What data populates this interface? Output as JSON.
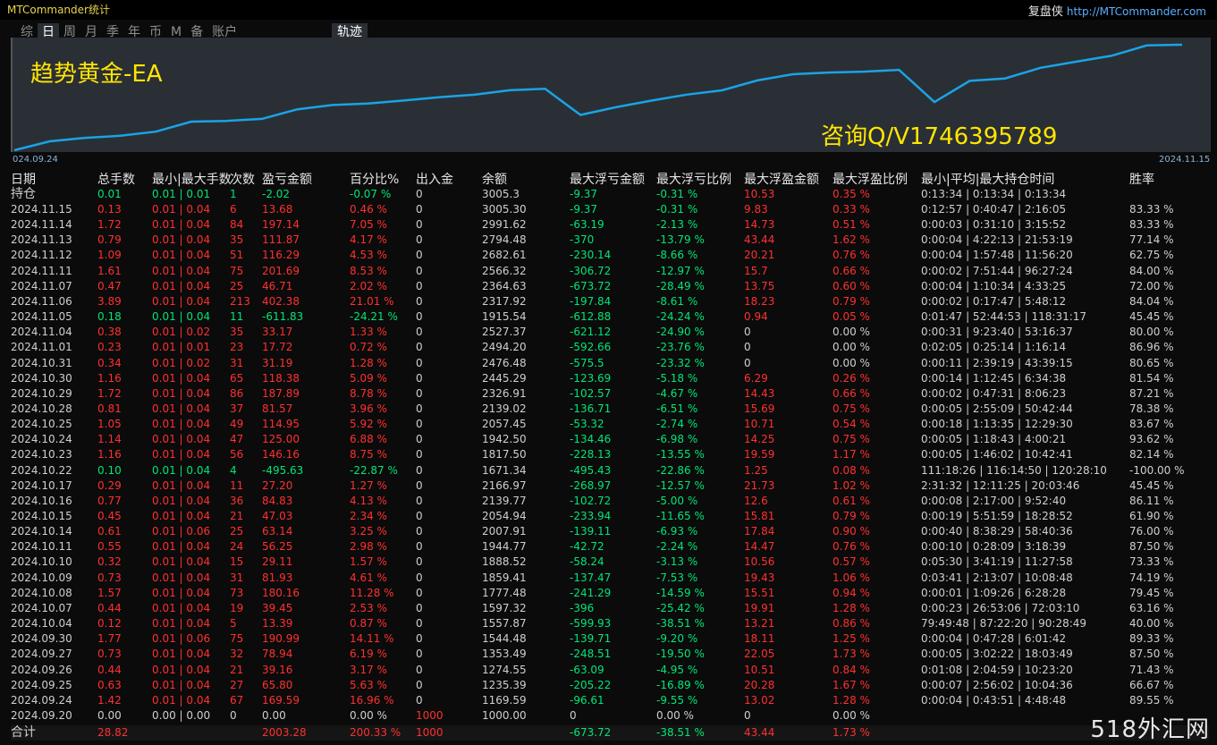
{
  "app": {
    "title": "MTCommander统计",
    "brand_cn": "复盘侠",
    "brand_url": "http://MTCommander.com"
  },
  "tabs": [
    "综",
    "日",
    "周",
    "月",
    "季",
    "年",
    "币",
    "M",
    "备",
    "账户"
  ],
  "active_tab": "日",
  "track_label": "轨迹",
  "chart": {
    "ea_name": "趋势黄金-EA",
    "contact": "咨询Q/V1746395789",
    "date_start": "024.09.24",
    "date_end": "2024.11.15",
    "line_color": "#1aa3e6",
    "balance_series": [
      1000,
      1169.59,
      1235.39,
      1274.55,
      1353.49,
      1544.48,
      1557.87,
      1597.32,
      1777.48,
      1859.41,
      1888.52,
      1944.77,
      2007.91,
      2054.94,
      2139.77,
      2166.97,
      1671.34,
      1817.5,
      1942.5,
      2057.45,
      2139.02,
      2326.91,
      2445.29,
      2476.48,
      2494.2,
      2527.37,
      1915.54,
      2317.92,
      2364.63,
      2566.32,
      2682.61,
      2794.48,
      2991.62,
      3005.3
    ]
  },
  "colors": {
    "profit": "#ff3030",
    "loss": "#00e676",
    "neutral": "#cfcfcf",
    "accent_yellow": "#ffe600"
  },
  "headers": [
    "日期",
    "总手数",
    "最小|最大手数",
    "次数",
    "盈亏金额",
    "百分比%",
    "出入金",
    "余额",
    "最大浮亏金额",
    "最大浮亏比例",
    "最大浮盈金额",
    "最大浮盈比例",
    "最小|平均|最大持仓时间",
    "胜率"
  ],
  "position_row": [
    "持仓",
    "0.01",
    "0.01 | 0.01",
    "1",
    "-2.02",
    "-0.07 %",
    "0",
    "3005.3",
    "-9.37",
    "-0.31 %",
    "10.53",
    "0.35 %",
    "0:13:34 | 0:13:34 | 0:13:34",
    ""
  ],
  "rows": [
    [
      "2024.11.15",
      "0.13",
      "0.01 | 0.04",
      "6",
      "13.68",
      "0.46 %",
      "0",
      "3005.30",
      "-9.37",
      "-0.31 %",
      "9.83",
      "0.33 %",
      "0:12:57 | 0:40:47 | 2:16:05",
      "83.33 %"
    ],
    [
      "2024.11.14",
      "1.72",
      "0.01 | 0.04",
      "84",
      "197.14",
      "7.05 %",
      "0",
      "2991.62",
      "-63.19",
      "-2.13 %",
      "14.73",
      "0.51 %",
      "0:00:03 | 0:31:10 | 3:15:52",
      "83.33 %"
    ],
    [
      "2024.11.13",
      "0.79",
      "0.01 | 0.04",
      "35",
      "111.87",
      "4.17 %",
      "0",
      "2794.48",
      "-370",
      "-13.79 %",
      "43.44",
      "1.62 %",
      "0:00:04 | 4:22:13 | 21:53:19",
      "77.14 %"
    ],
    [
      "2024.11.12",
      "1.09",
      "0.01 | 0.04",
      "51",
      "116.29",
      "4.53 %",
      "0",
      "2682.61",
      "-230.14",
      "-8.66 %",
      "20.21",
      "0.76 %",
      "0:00:04 | 1:57:48 | 11:56:20",
      "62.75 %"
    ],
    [
      "2024.11.11",
      "1.61",
      "0.01 | 0.04",
      "75",
      "201.69",
      "8.53 %",
      "0",
      "2566.32",
      "-306.72",
      "-12.97 %",
      "15.7",
      "0.66 %",
      "0:00:02 | 7:51:44 | 96:27:24",
      "84.00 %"
    ],
    [
      "2024.11.07",
      "0.47",
      "0.01 | 0.04",
      "25",
      "46.71",
      "2.02 %",
      "0",
      "2364.63",
      "-673.72",
      "-28.49 %",
      "13.75",
      "0.60 %",
      "0:00:04 | 1:10:34 | 4:33:25",
      "72.00 %"
    ],
    [
      "2024.11.06",
      "3.89",
      "0.01 | 0.04",
      "213",
      "402.38",
      "21.01 %",
      "0",
      "2317.92",
      "-197.84",
      "-8.61 %",
      "18.23",
      "0.79 %",
      "0:00:02 | 0:17:47 | 5:48:12",
      "84.04 %"
    ],
    [
      "2024.11.05",
      "0.18",
      "0.01 | 0.04",
      "11",
      "-611.83",
      "-24.21 %",
      "0",
      "1915.54",
      "-612.88",
      "-24.24 %",
      "0.94",
      "0.05 %",
      "0:01:47 | 52:44:53 | 118:31:17",
      "45.45 %"
    ],
    [
      "2024.11.04",
      "0.38",
      "0.01 | 0.02",
      "35",
      "33.17",
      "1.33 %",
      "0",
      "2527.37",
      "-621.12",
      "-24.90 %",
      "0",
      "0.00 %",
      "0:00:31 | 9:23:40 | 53:16:37",
      "80.00 %"
    ],
    [
      "2024.11.01",
      "0.23",
      "0.01 | 0.01",
      "23",
      "17.72",
      "0.72 %",
      "0",
      "2494.20",
      "-592.66",
      "-23.76 %",
      "0",
      "0.00 %",
      "0:02:05 | 0:25:14 | 1:16:14",
      "86.96 %"
    ],
    [
      "2024.10.31",
      "0.34",
      "0.01 | 0.02",
      "31",
      "31.19",
      "1.28 %",
      "0",
      "2476.48",
      "-575.5",
      "-23.32 %",
      "0",
      "0.00 %",
      "0:00:11 | 2:39:19 | 43:39:15",
      "80.65 %"
    ],
    [
      "2024.10.30",
      "1.16",
      "0.01 | 0.04",
      "65",
      "118.38",
      "5.09 %",
      "0",
      "2445.29",
      "-123.69",
      "-5.18 %",
      "6.29",
      "0.26 %",
      "0:00:14 | 1:12:45 | 6:34:38",
      "81.54 %"
    ],
    [
      "2024.10.29",
      "1.72",
      "0.01 | 0.04",
      "86",
      "187.89",
      "8.78 %",
      "0",
      "2326.91",
      "-102.57",
      "-4.67 %",
      "14.43",
      "0.66 %",
      "0:00:02 | 0:47:31 | 8:06:23",
      "87.21 %"
    ],
    [
      "2024.10.28",
      "0.81",
      "0.01 | 0.04",
      "37",
      "81.57",
      "3.96 %",
      "0",
      "2139.02",
      "-136.71",
      "-6.51 %",
      "15.69",
      "0.75 %",
      "0:00:05 | 2:55:09 | 50:42:44",
      "78.38 %"
    ],
    [
      "2024.10.25",
      "1.05",
      "0.01 | 0.04",
      "49",
      "114.95",
      "5.92 %",
      "0",
      "2057.45",
      "-53.32",
      "-2.74 %",
      "10.71",
      "0.54 %",
      "0:00:18 | 1:13:35 | 12:29:30",
      "83.67 %"
    ],
    [
      "2024.10.24",
      "1.14",
      "0.01 | 0.04",
      "47",
      "125.00",
      "6.88 %",
      "0",
      "1942.50",
      "-134.46",
      "-6.98 %",
      "14.25",
      "0.75 %",
      "0:00:05 | 1:18:43 | 4:00:21",
      "93.62 %"
    ],
    [
      "2024.10.23",
      "1.16",
      "0.01 | 0.04",
      "56",
      "146.16",
      "8.75 %",
      "0",
      "1817.50",
      "-228.13",
      "-13.55 %",
      "19.59",
      "1.17 %",
      "0:00:05 | 1:46:02 | 10:42:41",
      "82.14 %"
    ],
    [
      "2024.10.22",
      "0.10",
      "0.01 | 0.04",
      "4",
      "-495.63",
      "-22.87 %",
      "0",
      "1671.34",
      "-495.43",
      "-22.86 %",
      "1.25",
      "0.08 %",
      "111:18:26 | 116:14:50 | 120:28:10",
      "-100.00 %"
    ],
    [
      "2024.10.17",
      "0.29",
      "0.01 | 0.04",
      "11",
      "27.20",
      "1.27 %",
      "0",
      "2166.97",
      "-268.97",
      "-12.57 %",
      "21.73",
      "1.02 %",
      "2:31:32 | 12:11:25 | 20:03:46",
      "45.45 %"
    ],
    [
      "2024.10.16",
      "0.77",
      "0.01 | 0.04",
      "36",
      "84.83",
      "4.13 %",
      "0",
      "2139.77",
      "-102.72",
      "-5.00 %",
      "12.6",
      "0.61 %",
      "0:00:08 | 2:17:00 | 9:52:40",
      "86.11 %"
    ],
    [
      "2024.10.15",
      "0.45",
      "0.01 | 0.04",
      "21",
      "47.03",
      "2.34 %",
      "0",
      "2054.94",
      "-233.94",
      "-11.65 %",
      "15.81",
      "0.79 %",
      "0:00:19 | 5:51:59 | 18:28:52",
      "61.90 %"
    ],
    [
      "2024.10.14",
      "0.61",
      "0.01 | 0.06",
      "25",
      "63.14",
      "3.25 %",
      "0",
      "2007.91",
      "-139.11",
      "-6.93 %",
      "17.84",
      "0.90 %",
      "0:00:40 | 8:38:29 | 58:40:36",
      "76.00 %"
    ],
    [
      "2024.10.11",
      "0.55",
      "0.01 | 0.04",
      "24",
      "56.25",
      "2.98 %",
      "0",
      "1944.77",
      "-42.72",
      "-2.24 %",
      "14.47",
      "0.76 %",
      "0:00:10 | 0:28:09 | 3:18:39",
      "87.50 %"
    ],
    [
      "2024.10.10",
      "0.32",
      "0.01 | 0.04",
      "15",
      "29.11",
      "1.57 %",
      "0",
      "1888.52",
      "-58.24",
      "-3.13 %",
      "10.56",
      "0.57 %",
      "0:05:30 | 3:41:19 | 11:27:58",
      "73.33 %"
    ],
    [
      "2024.10.09",
      "0.73",
      "0.01 | 0.04",
      "31",
      "81.93",
      "4.61 %",
      "0",
      "1859.41",
      "-137.47",
      "-7.53 %",
      "19.43",
      "1.06 %",
      "0:03:41 | 2:13:07 | 10:08:48",
      "74.19 %"
    ],
    [
      "2024.10.08",
      "1.57",
      "0.01 | 0.04",
      "73",
      "180.16",
      "11.28 %",
      "0",
      "1777.48",
      "-241.29",
      "-14.59 %",
      "15.51",
      "0.94 %",
      "0:00:01 | 1:09:26 | 6:28:28",
      "79.45 %"
    ],
    [
      "2024.10.07",
      "0.44",
      "0.01 | 0.04",
      "19",
      "39.45",
      "2.53 %",
      "0",
      "1597.32",
      "-396",
      "-25.42 %",
      "19.91",
      "1.28 %",
      "0:00:23 | 26:53:06 | 72:03:10",
      "63.16 %"
    ],
    [
      "2024.10.04",
      "0.12",
      "0.01 | 0.04",
      "5",
      "13.39",
      "0.87 %",
      "0",
      "1557.87",
      "-599.93",
      "-38.51 %",
      "13.21",
      "0.86 %",
      "79:49:48 | 87:22:20 | 90:28:49",
      "40.00 %"
    ],
    [
      "2024.09.30",
      "1.77",
      "0.01 | 0.06",
      "75",
      "190.99",
      "14.11 %",
      "0",
      "1544.48",
      "-139.71",
      "-9.20 %",
      "18.11",
      "1.25 %",
      "0:00:04 | 0:47:28 | 6:01:42",
      "89.33 %"
    ],
    [
      "2024.09.27",
      "0.73",
      "0.01 | 0.04",
      "32",
      "78.94",
      "6.19 %",
      "0",
      "1353.49",
      "-248.51",
      "-19.50 %",
      "22.05",
      "1.73 %",
      "0:00:05 | 3:02:22 | 18:03:49",
      "87.50 %"
    ],
    [
      "2024.09.26",
      "0.44",
      "0.01 | 0.04",
      "21",
      "39.16",
      "3.17 %",
      "0",
      "1274.55",
      "-63.09",
      "-4.95 %",
      "10.51",
      "0.84 %",
      "0:01:08 | 2:04:59 | 10:23:20",
      "71.43 %"
    ],
    [
      "2024.09.25",
      "0.63",
      "0.01 | 0.04",
      "27",
      "65.80",
      "5.63 %",
      "0",
      "1235.39",
      "-205.22",
      "-16.89 %",
      "20.28",
      "1.67 %",
      "0:00:07 | 2:56:02 | 10:04:36",
      "66.67 %"
    ],
    [
      "2024.09.24",
      "1.42",
      "0.01 | 0.04",
      "67",
      "169.59",
      "16.96 %",
      "0",
      "1169.59",
      "-96.61",
      "-9.55 %",
      "13.02",
      "1.28 %",
      "0:00:04 | 0:43:51 | 4:48:48",
      "89.55 %"
    ],
    [
      "2024.09.20",
      "0.00",
      "0.00 | 0.00",
      "0",
      "0.00",
      "0.00 %",
      "1000",
      "1000.00",
      "0",
      "0.00 %",
      "0",
      "0.00 %",
      "",
      ""
    ]
  ],
  "total_row": [
    "合计",
    "28.82",
    "",
    "",
    "2003.28",
    "200.33 %",
    "1000",
    "",
    "-673.72",
    "-38.51 %",
    "43.44",
    "1.73 %",
    "",
    ""
  ],
  "watermark": "518外汇网"
}
